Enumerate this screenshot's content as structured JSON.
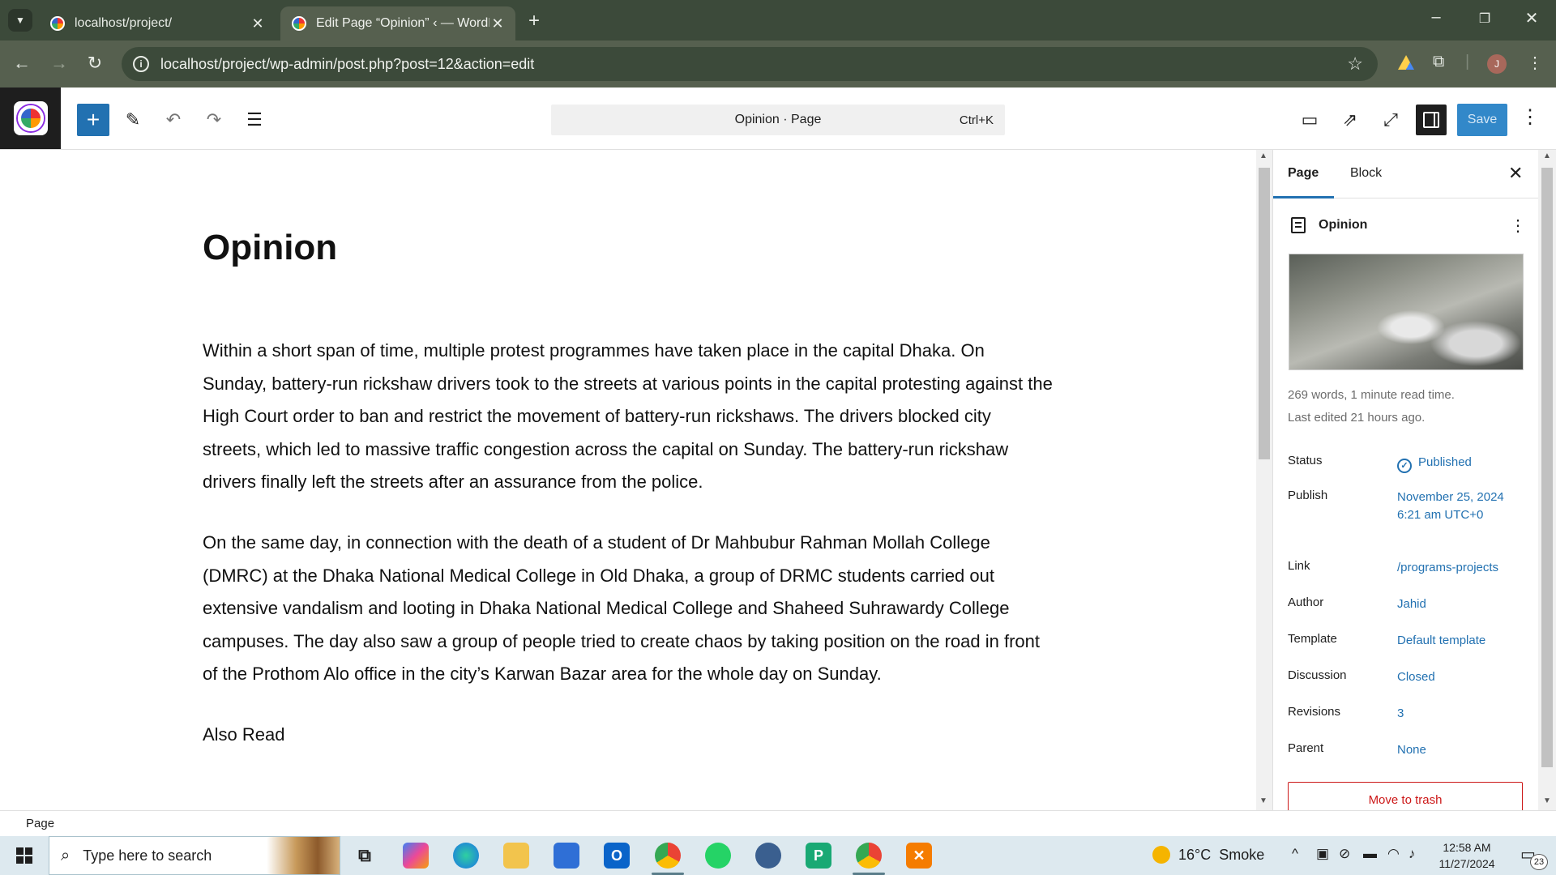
{
  "browser": {
    "tabs": [
      {
        "title": "localhost/project/",
        "active": false
      },
      {
        "title": "Edit Page “Opinion” ‹ — WordPress",
        "active": true
      }
    ],
    "url": "localhost/project/wp-admin/post.php?post=12&action=edit",
    "profile_initial": "J"
  },
  "editor_header": {
    "command_bar": {
      "label": "Opinion · Page",
      "shortcut": "Ctrl+K"
    },
    "save_label": "Save"
  },
  "content": {
    "title": "Opinion",
    "paragraphs": [
      "Within a short span of time, multiple protest programmes have taken place in the capital Dhaka. On Sunday, battery-run rickshaw drivers took to the streets at various points in the capital protesting against the High Court order to ban and restrict the movement of battery-run rickshaws. The drivers blocked city streets, which led to massive traffic congestion across the capital on Sunday. The battery-run rickshaw drivers finally left the streets after an assurance from the police.",
      "On the same day, in connection with the death of a student of Dr Mahbubur Rahman Mollah College (DMRC) at the Dhaka National Medical College in Old Dhaka, a group of DRMC students carried out extensive vandalism and looting in Dhaka National Medical College and Shaheed Suhrawardy College campuses. The day also saw a group of people tried to create chaos by taking position on the road in front of the Prothom Alo office in the city’s Karwan Bazar area for the whole day on Sunday.",
      "Also Read"
    ]
  },
  "sidebar": {
    "tabs": [
      "Page",
      "Block"
    ],
    "doc_title": "Opinion",
    "stats": "269 words, 1 minute read time.",
    "last_edited": "Last edited 21 hours ago.",
    "props": {
      "status": {
        "label": "Status",
        "value": "Published"
      },
      "publish": {
        "label": "Publish",
        "value": "November 25, 2024 6:21 am UTC+0"
      },
      "link": {
        "label": "Link",
        "value": "/programs-projects"
      },
      "author": {
        "label": "Author",
        "value": "Jahid"
      },
      "template": {
        "label": "Template",
        "value": "Default template"
      },
      "discussion": {
        "label": "Discussion",
        "value": "Closed"
      },
      "revisions": {
        "label": "Revisions",
        "value": "3"
      },
      "parent": {
        "label": "Parent",
        "value": "None"
      }
    },
    "trash_label": "Move to trash"
  },
  "footer": {
    "breadcrumb": "Page"
  },
  "taskbar": {
    "search_placeholder": "Type here to search",
    "weather": {
      "temp": "16°C",
      "condition": "Smoke"
    },
    "time": "12:58 AM",
    "date": "11/27/2024",
    "notification_count": "23"
  },
  "colors": {
    "accent": "#2271b1",
    "danger": "#cc1818",
    "chrome_dark": "#3c4a3a",
    "chrome_mid": "#56604f"
  }
}
